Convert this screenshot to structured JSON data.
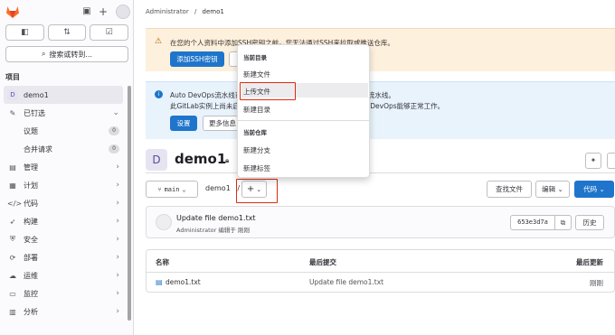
{
  "sidebar": {
    "search_label": "搜索或转到...",
    "section_title": "项目",
    "items": [
      {
        "label": "demo1",
        "icon": "project-avatar-D"
      },
      {
        "label": "已钉选",
        "icon": "pin-icon"
      },
      {
        "label": "议题",
        "count": "0"
      },
      {
        "label": "合并请求",
        "count": "0"
      },
      {
        "label": "管理",
        "icon": "briefcase-icon"
      },
      {
        "label": "计划",
        "icon": "calendar-icon"
      },
      {
        "label": "代码",
        "icon": "code-icon"
      },
      {
        "label": "构建",
        "icon": "rocket-icon"
      },
      {
        "label": "安全",
        "icon": "shield-icon"
      },
      {
        "label": "部署",
        "icon": "deployments-icon"
      },
      {
        "label": "运维",
        "icon": "cloud-icon"
      },
      {
        "label": "监控",
        "icon": "monitor-icon"
      },
      {
        "label": "分析",
        "icon": "chart-icon"
      }
    ]
  },
  "breadcrumb": {
    "root": "Administrator",
    "sep": "/",
    "current": "demo1"
  },
  "ssh_alert": {
    "text": "在您的个人资料中添加SSH密钥之前，您无法通过SSH来拉取或推送仓库。",
    "add_button": "添加SSH密钥"
  },
  "devops_alert": {
    "line1": "Auto DevOps流水线已启用，如果未找到 CI 配置文件，将使用该流水线。",
    "line2": "此GitLab实例上尚未启用 Kubernetes 集成，请启用以确保 Auto DevOps能够正常工作。",
    "settings_button": "设置",
    "more_button": "更多信息"
  },
  "project": {
    "avatar_letter": "D",
    "name": "demo1"
  },
  "repo": {
    "branch": "main",
    "path": "demo1",
    "path_sep": "/",
    "plus_label": "+",
    "find_file": "查找文件",
    "edit": "编辑",
    "code": "代码"
  },
  "commit": {
    "message": "Update file demo1.txt",
    "author_line": "Administrator 编辑于 刚刚",
    "sha": "653e3d7a",
    "history": "历史"
  },
  "table": {
    "headers": [
      "名称",
      "最后提交",
      "最后更新"
    ],
    "rows": [
      {
        "name": "demo1.txt",
        "commit": "Update file demo1.txt",
        "updated": "刚刚"
      }
    ]
  },
  "dropdown": {
    "group1_title": "当前目录",
    "group1_items": [
      "新建文件",
      "上传文件",
      "新建目录"
    ],
    "group2_title": "当前仓库",
    "group2_items": [
      "新建分支",
      "新建标签"
    ]
  },
  "colors": {
    "accent": "#1f75cb",
    "highlight_box": "#dd2b0e",
    "warning_bg": "#fdf1dd",
    "info_bg": "#e9f3fc"
  }
}
